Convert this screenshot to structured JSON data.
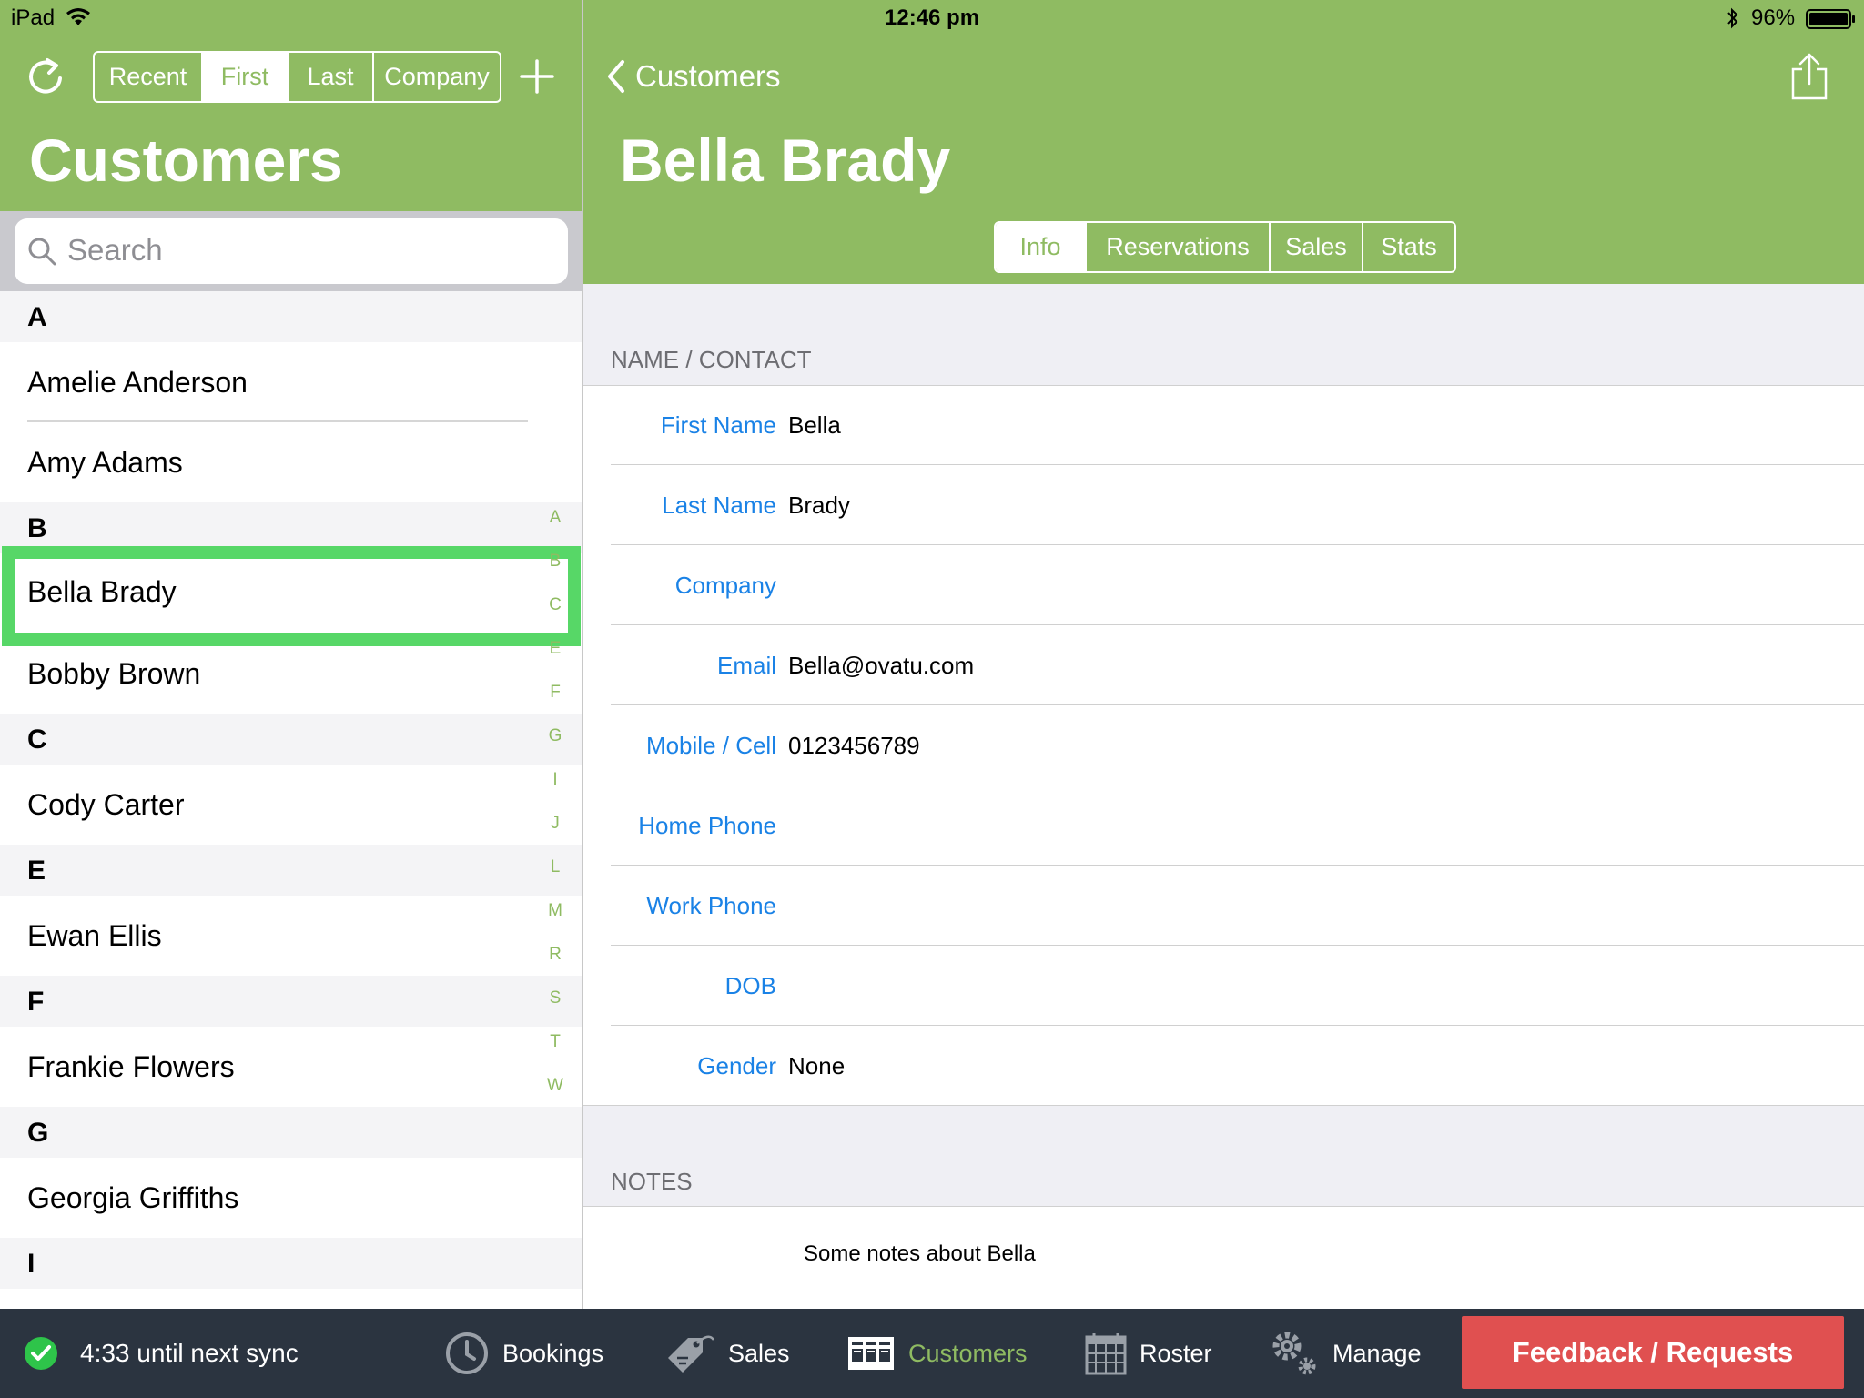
{
  "status_bar": {
    "device": "iPad",
    "time": "12:46 pm",
    "battery": "96%"
  },
  "left": {
    "segments": [
      {
        "label": "Recent",
        "active": false
      },
      {
        "label": "First",
        "active": true
      },
      {
        "label": "Last",
        "active": false
      },
      {
        "label": "Company",
        "active": false
      }
    ],
    "title": "Customers",
    "search_placeholder": "Search",
    "sections": [
      {
        "letter": "A",
        "items": [
          "Amelie Anderson",
          "Amy Adams"
        ]
      },
      {
        "letter": "B",
        "items": [
          "Bella Brady",
          "Bobby Brown"
        ]
      },
      {
        "letter": "C",
        "items": [
          "Cody  Carter"
        ]
      },
      {
        "letter": "E",
        "items": [
          "Ewan Ellis"
        ]
      },
      {
        "letter": "F",
        "items": [
          "Frankie Flowers"
        ]
      },
      {
        "letter": "G",
        "items": [
          "Georgia Griffiths"
        ]
      },
      {
        "letter": "I",
        "items": []
      }
    ],
    "index_letters": [
      "A",
      "B",
      "C",
      "E",
      "F",
      "G",
      "I",
      "J",
      "L",
      "M",
      "R",
      "S",
      "T",
      "W"
    ]
  },
  "right": {
    "back_label": "Customers",
    "title": "Bella Brady",
    "tabs": [
      {
        "label": "Info",
        "active": true
      },
      {
        "label": "Reservations",
        "active": false
      },
      {
        "label": "Sales",
        "active": false
      },
      {
        "label": "Stats",
        "active": false
      }
    ],
    "contact_section": "NAME / CONTACT",
    "fields": [
      {
        "label": "First Name",
        "value": "Bella"
      },
      {
        "label": "Last Name",
        "value": "Brady"
      },
      {
        "label": "Company",
        "value": ""
      },
      {
        "label": "Email",
        "value": "Bella@ovatu.com"
      },
      {
        "label": "Mobile / Cell",
        "value": "0123456789"
      },
      {
        "label": "Home Phone",
        "value": ""
      },
      {
        "label": "Work Phone",
        "value": ""
      },
      {
        "label": "DOB",
        "value": ""
      },
      {
        "label": "Gender",
        "value": "None"
      }
    ],
    "notes_section": "NOTES",
    "notes": "Some notes about Bella"
  },
  "tabbar": {
    "sync": "4:33 until next sync",
    "items": [
      {
        "label": "Bookings",
        "icon": "clock-icon",
        "active": false
      },
      {
        "label": "Sales",
        "icon": "tag-icon",
        "active": false
      },
      {
        "label": "Customers",
        "icon": "customers-icon",
        "active": true
      },
      {
        "label": "Roster",
        "icon": "calendar-icon",
        "active": false
      },
      {
        "label": "Manage",
        "icon": "gears-icon",
        "active": false
      }
    ],
    "feedback": "Feedback / Requests"
  },
  "colors": {
    "brand_green": "#8fbb62",
    "selection_green": "#57d767",
    "link_blue": "#1a82e6",
    "tabbar_bg": "#2b3440",
    "feedback_red": "#e05050"
  }
}
